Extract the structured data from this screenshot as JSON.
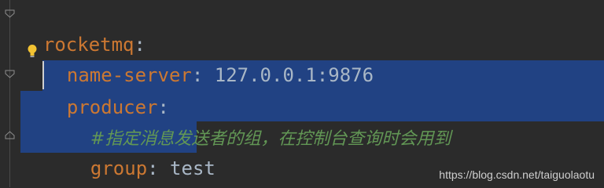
{
  "editor": {
    "language": "yaml",
    "lines": [
      {
        "key": "rocketmq",
        "colon": ":",
        "value": ""
      },
      {
        "key": "name-server",
        "colon": ":",
        "value": " 127.0.0.1:9876"
      },
      {
        "key": "producer",
        "colon": ":",
        "value": ""
      },
      {
        "comment": "#指定消息发送者的组，在控制台查询时会用到"
      },
      {
        "key": "group",
        "colon": ":",
        "value": " test"
      }
    ]
  },
  "icons": {
    "fold": "fold-arrow-icon",
    "intention": "lightbulb-icon"
  },
  "colors": {
    "background": "#2b2b2b",
    "key": "#cc7832",
    "value": "#a9b7c6",
    "comment": "#629755",
    "selection": "#214283"
  },
  "watermark": "https://blog.csdn.net/taiguolaotu"
}
